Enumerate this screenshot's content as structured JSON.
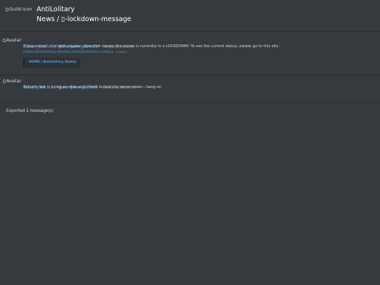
{
  "header": {
    "guild_icon_alt": "Guild icon",
    "guild_name": "AntiLolitary",
    "channel_path": "News / ▯-lockdown-message"
  },
  "messages": [
    {
      "avatar_alt": "Avatar",
      "author": "Ethan_boi....... (pew pew gamer)",
      "timestamp": "20-Jan-22 09:58 PM",
      "lines": [
        "if you cannot chat with anyone, then that means the server is currently in a LOCKDOWN! To see the current status, please go to this site:"
      ],
      "link": "https://antilolitary.wixsite.com/antilolitary-status",
      "edited_label": "(edited)",
      "embed_title": "HOME | Antilolitary Status"
    },
    {
      "avatar_alt": "Avatar",
      "author": "Ethan_boi....... (pew pew gamer)",
      "timestamp": "30-Mar-22 06:02 PM",
      "lines": [
        "Security bot is being an idiot and I think locked the server down...hang on"
      ]
    }
  ],
  "footer": {
    "export_summary": "Exported 2 message(s)"
  },
  "colors": {
    "background": "#36393e",
    "author": "#5fb2f0",
    "link": "#3aa0d9",
    "embed_background": "#2f3136"
  }
}
